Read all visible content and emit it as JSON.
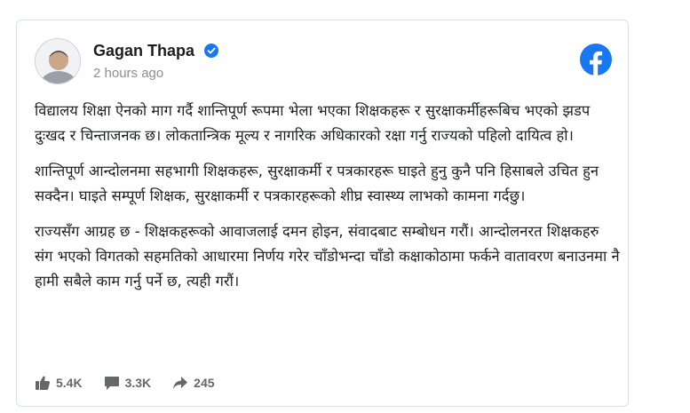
{
  "post": {
    "author": "Gagan Thapa",
    "timestamp": "2 hours ago",
    "paragraphs": [
      "विद्यालय शिक्षा ऐनको माग गर्दै शान्तिपूर्ण रूपमा भेला भएका शिक्षकहरू र सुरक्षाकर्मीहरूबिच भएको झडप दुःखद र चिन्ताजनक छ। लोकतान्त्रिक मूल्य र नागरिक अधिकारको रक्षा गर्नु राज्यको पहिलो दायित्व हो।",
      "शान्तिपूर्ण आन्दोलनमा सहभागी शिक्षकहरू, सुरक्षाकर्मी र पत्रकारहरू घाइते हुनु कुनै पनि हिसाबले उचित हुन सक्दैन। घाइते सम्पूर्ण शिक्षक, सुरक्षाकर्मी र पत्रकारहरूको शीघ्र स्वास्थ्य लाभको कामना गर्दछु।",
      "राज्यसँग आग्रह छ - शिक्षकहरूको आवाजलाई दमन होइन, संवादबाट सम्बोधन गरौं। आन्दोलनरत शिक्षकहरु संग भएको विगतको सहमतिको आधारमा निर्णय गरेर चाँडोभन्दा चाँडो कक्षाकोठामा फर्कने वातावरण बनाउनमा नै हामी सबैले काम गर्नु पर्ने छ, त्यही गरौं।"
    ],
    "stats": {
      "likes": "5.4K",
      "comments": "3.3K",
      "shares": "245"
    }
  },
  "icons": {
    "verified": "verified-badge-icon",
    "facebook": "facebook-logo-icon",
    "like": "thumbs-up-icon",
    "comment": "comment-icon",
    "share": "share-arrow-icon"
  },
  "colors": {
    "facebook_blue": "#1877f2",
    "verified_blue": "#1877f2",
    "meta_gray": "#65676b",
    "time_gray": "#8a8d91"
  }
}
